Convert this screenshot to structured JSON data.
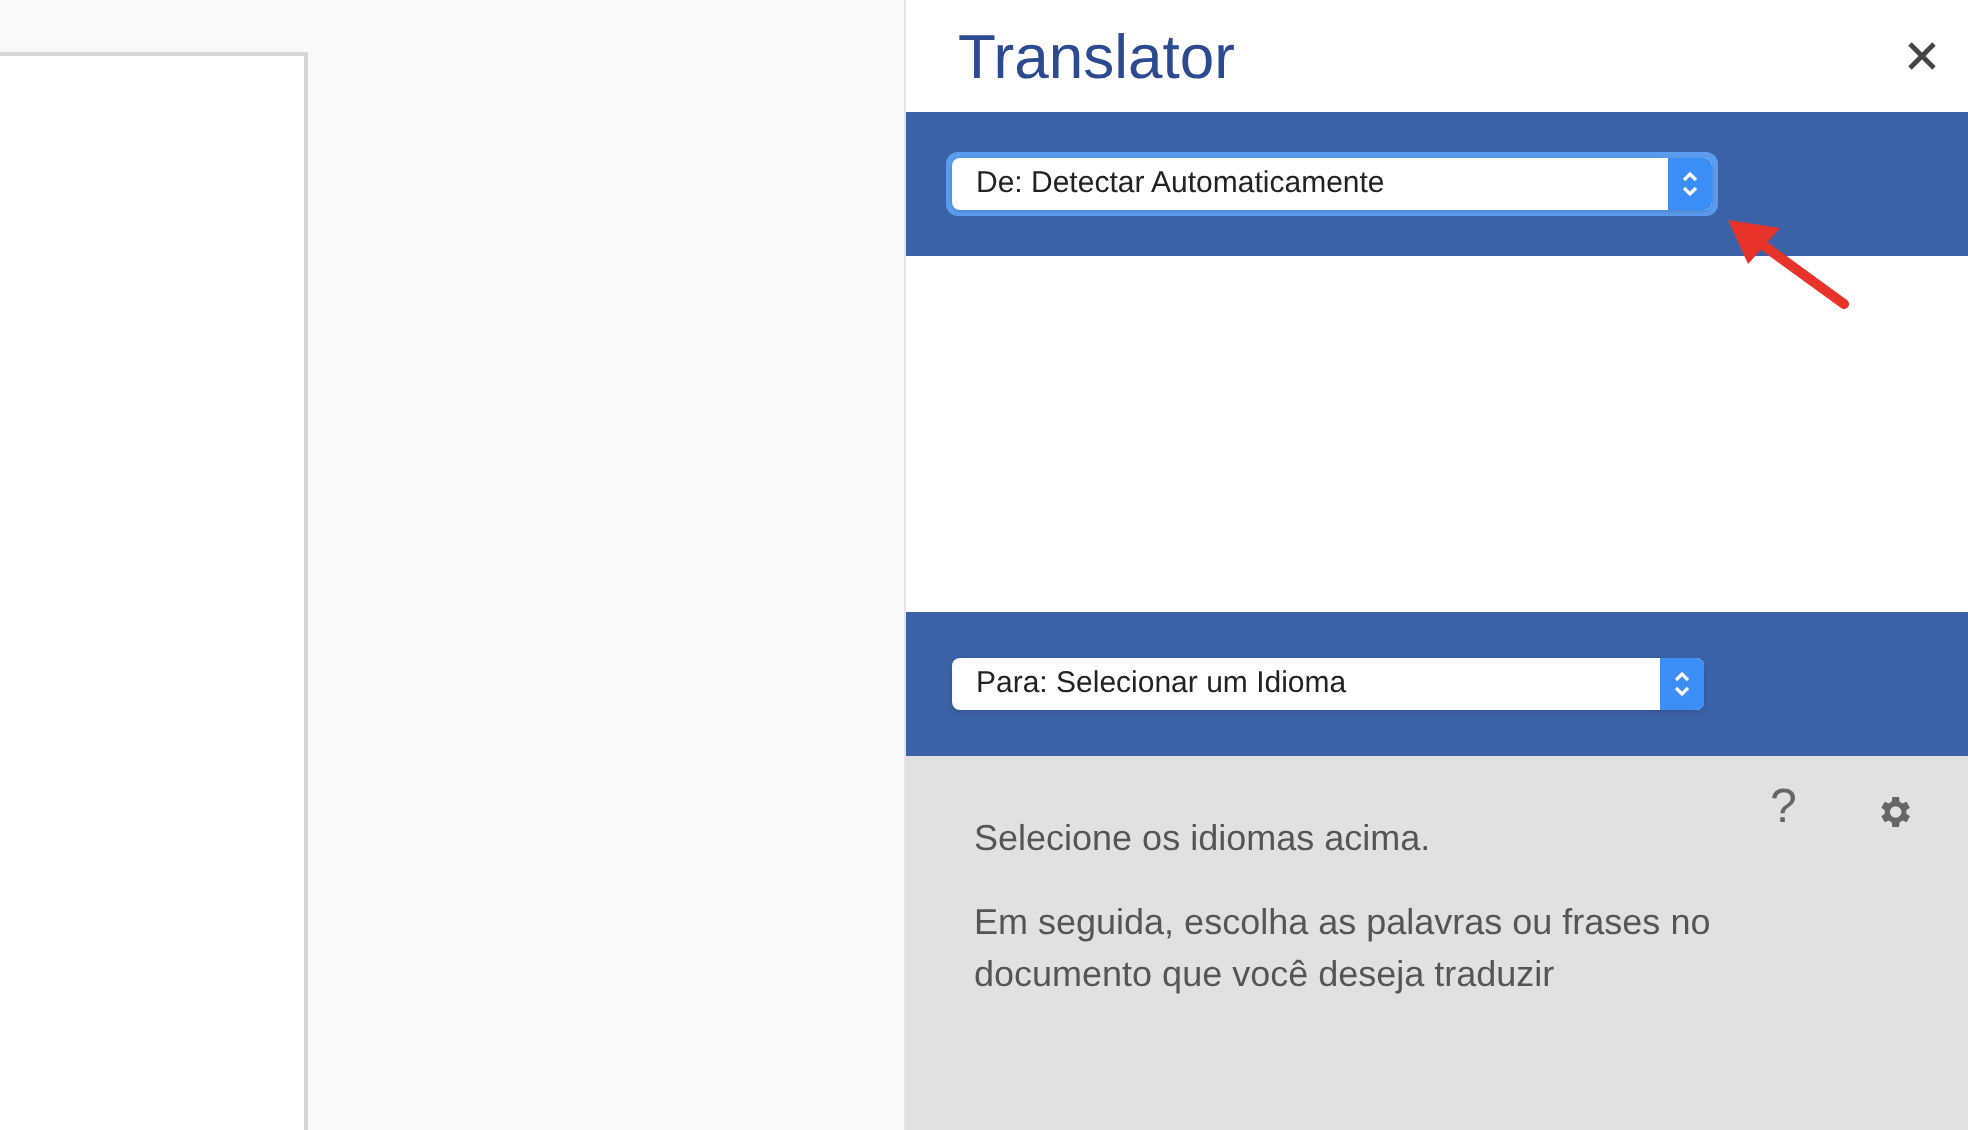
{
  "panel": {
    "title": "Translator",
    "source_language": {
      "value": "De: Detectar Automaticamente",
      "focused": true
    },
    "target_language": {
      "value": "Para: Selecionar um Idioma",
      "focused": false
    },
    "help": "?",
    "messages": [
      "Selecione os idiomas acima.",
      "Em seguida, escolha as palavras ou frases no documento que você deseja traduzir"
    ]
  }
}
